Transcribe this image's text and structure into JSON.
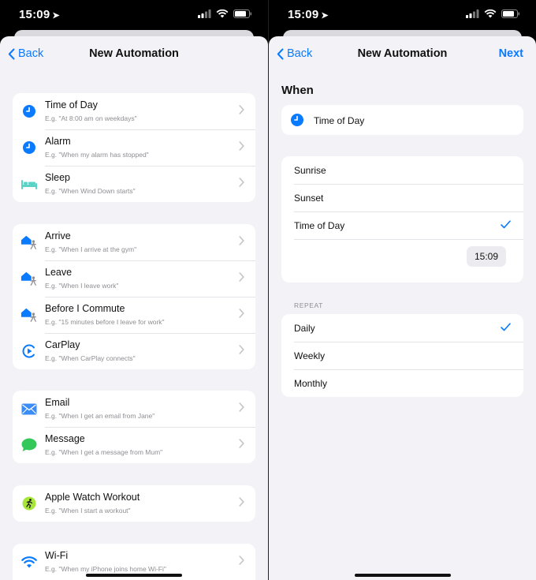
{
  "status": {
    "time": "15:09"
  },
  "left": {
    "back_label": "Back",
    "title": "New Automation",
    "groups": [
      [
        {
          "title": "Time of Day",
          "subtitle": "E.g. \"At 8:00 am on weekdays\"",
          "icon": "clock-icon"
        },
        {
          "title": "Alarm",
          "subtitle": "E.g. \"When my alarm has stopped\"",
          "icon": "alarm-icon"
        },
        {
          "title": "Sleep",
          "subtitle": "E.g. \"When Wind Down starts\"",
          "icon": "bed-icon"
        }
      ],
      [
        {
          "title": "Arrive",
          "subtitle": "E.g. \"When I arrive at the gym\"",
          "icon": "arrive-icon"
        },
        {
          "title": "Leave",
          "subtitle": "E.g. \"When I leave work\"",
          "icon": "leave-icon"
        },
        {
          "title": "Before I Commute",
          "subtitle": "E.g. \"15 minutes before I leave for work\"",
          "icon": "commute-icon"
        },
        {
          "title": "CarPlay",
          "subtitle": "E.g. \"When CarPlay connects\"",
          "icon": "carplay-icon"
        }
      ],
      [
        {
          "title": "Email",
          "subtitle": "E.g. \"When I get an email from Jane\"",
          "icon": "mail-icon"
        },
        {
          "title": "Message",
          "subtitle": "E.g. \"When I get a message from Mum\"",
          "icon": "message-icon"
        }
      ],
      [
        {
          "title": "Apple Watch Workout",
          "subtitle": "E.g. \"When I start a workout\"",
          "icon": "workout-icon"
        }
      ],
      [
        {
          "title": "Wi-Fi",
          "subtitle": "E.g. \"When my iPhone joins home Wi-Fi\"",
          "icon": "wifi-icon"
        }
      ]
    ]
  },
  "right": {
    "back_label": "Back",
    "title": "New Automation",
    "next_label": "Next",
    "section_title": "When",
    "selected_trigger": "Time of Day",
    "time_options": [
      "Sunrise",
      "Sunset",
      "Time of Day"
    ],
    "selected_time_option": "Time of Day",
    "time_value": "15:09",
    "repeat_label": "REPEAT",
    "repeat_options": [
      "Daily",
      "Weekly",
      "Monthly"
    ],
    "selected_repeat": "Daily"
  },
  "colors": {
    "accent": "#0a7aff",
    "background": "#f2f2f7",
    "workout": "#a8e63a",
    "sleep": "#5ad3c6",
    "message": "#34c759"
  }
}
